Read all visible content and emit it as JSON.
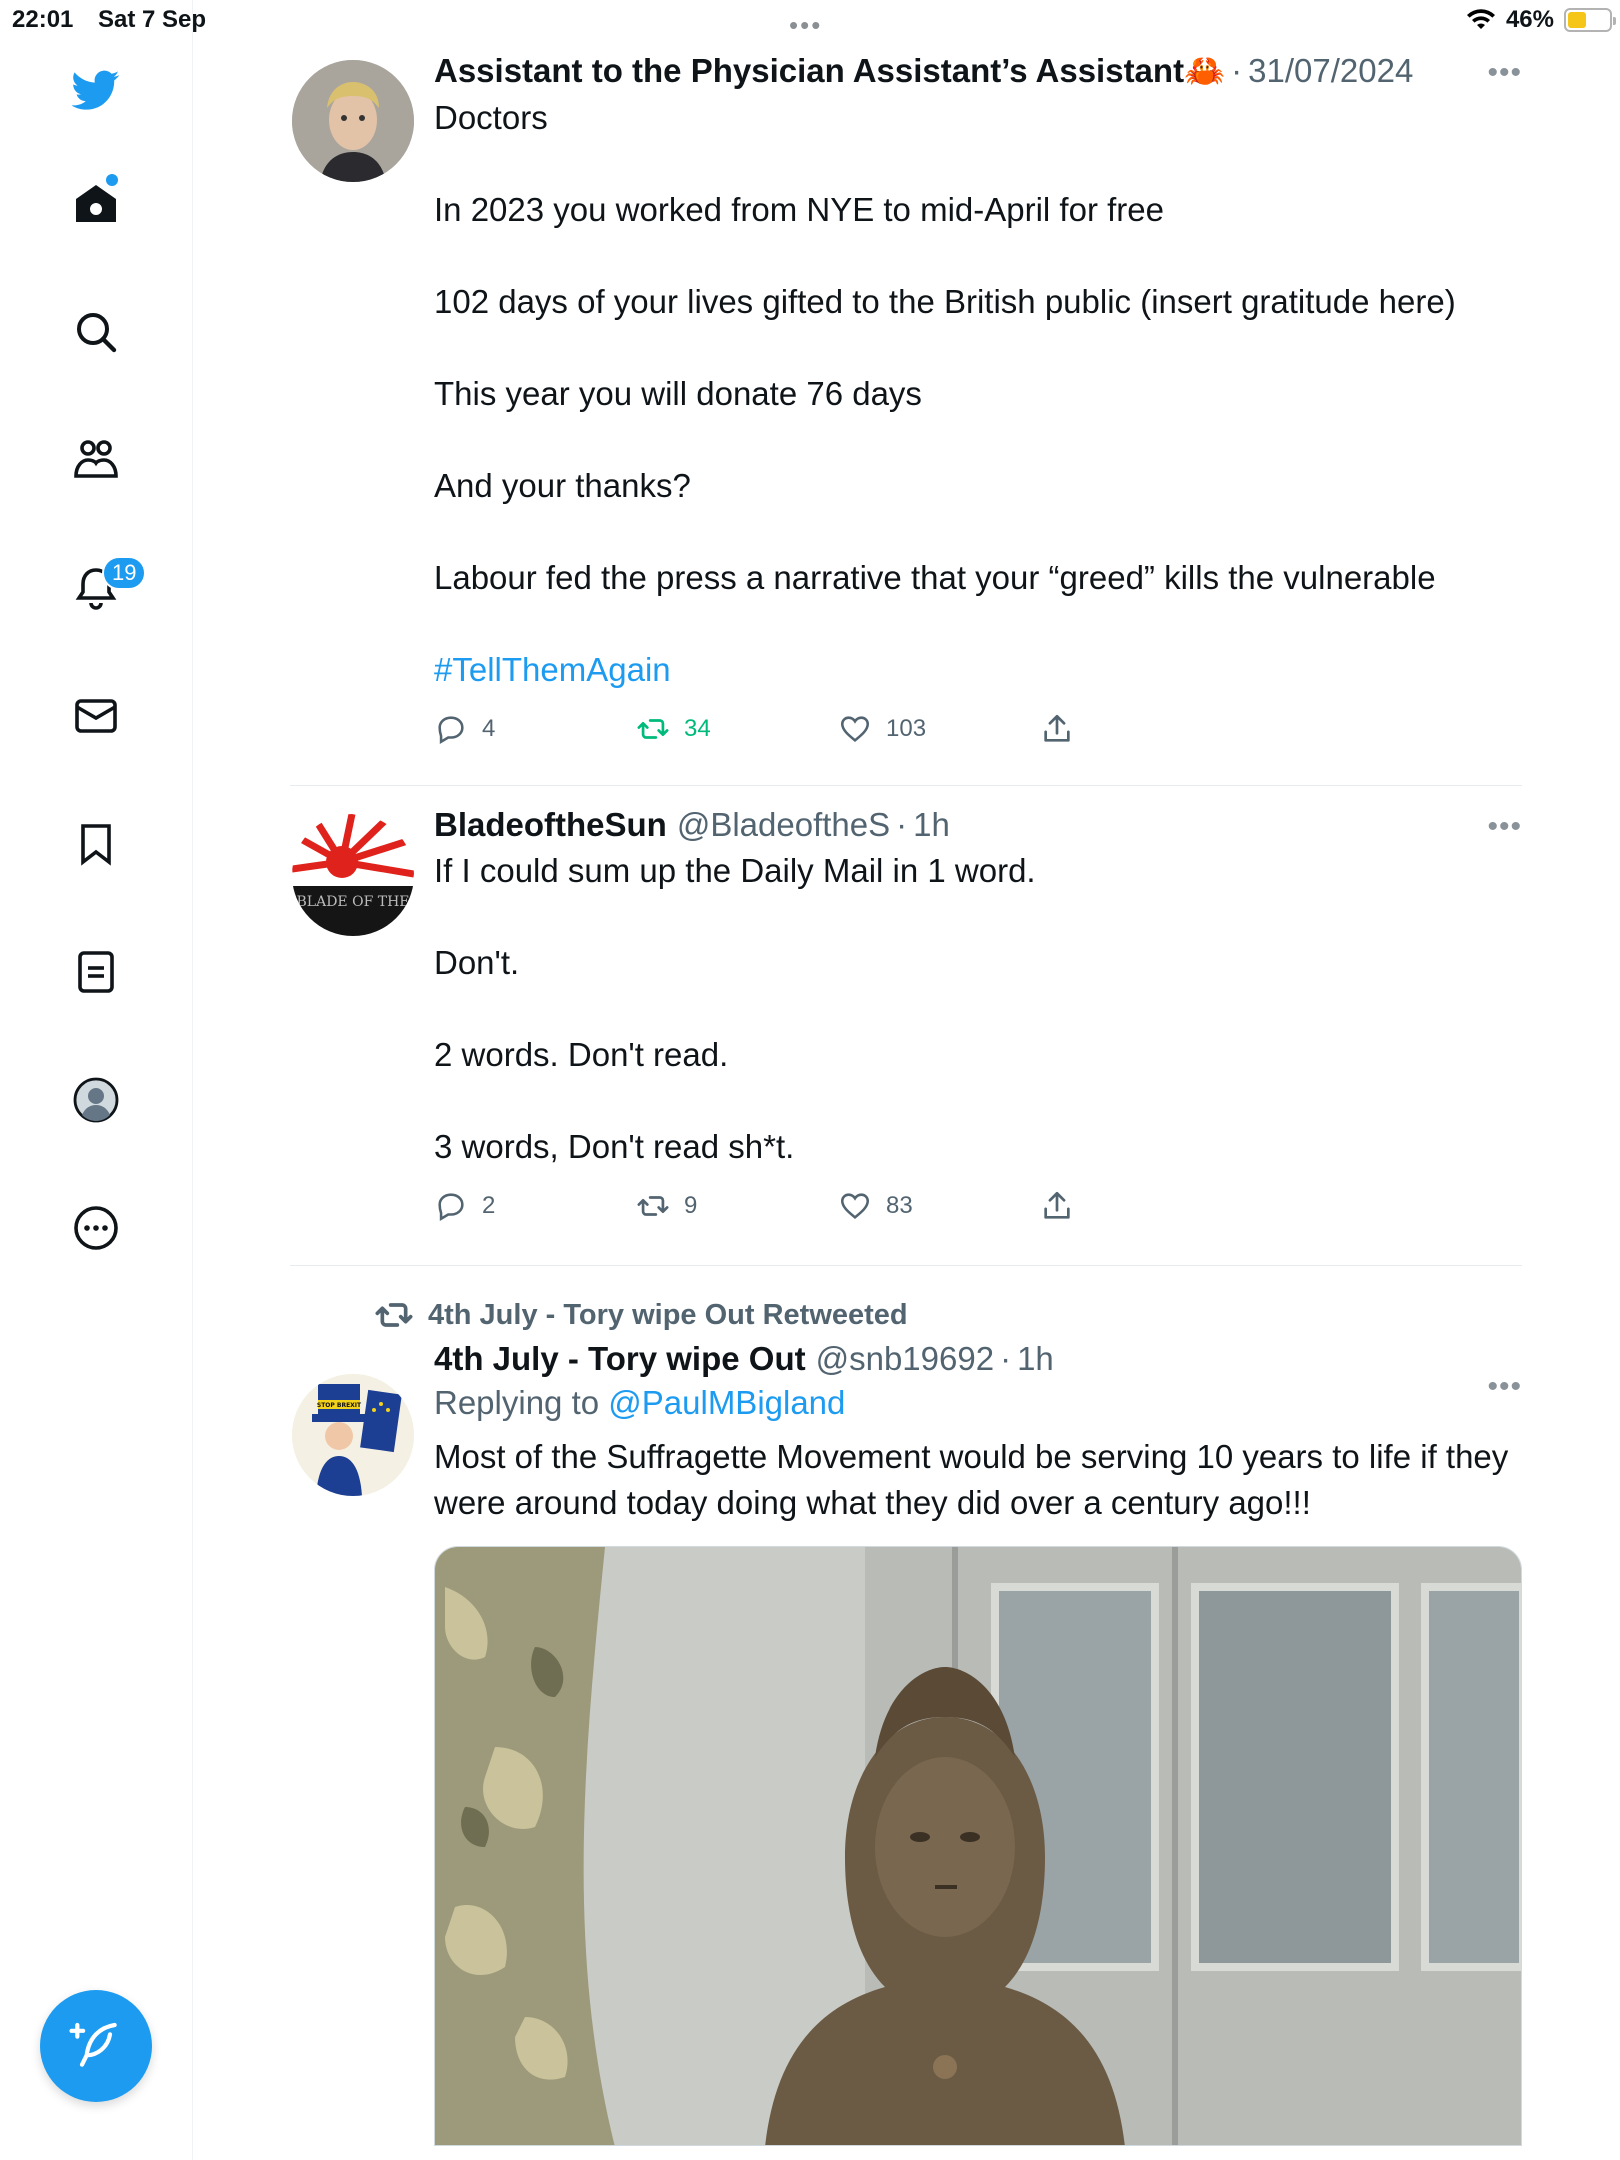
{
  "status_bar": {
    "time": "22:01",
    "date": "Sat 7 Sep",
    "battery": "46%",
    "battery_level": 0.46
  },
  "sidebar": {
    "notifications_badge": "19",
    "icons": [
      "twitter-logo",
      "home-icon",
      "search-icon",
      "communities-icon",
      "notifications-icon",
      "messages-icon",
      "bookmarks-icon",
      "lists-icon",
      "profile-icon",
      "more-icon",
      "compose-icon"
    ]
  },
  "tweets": [
    {
      "name": "Assistant to the Physician Assistant’s Assistant🦀",
      "handle": "",
      "time": "31/07/2024",
      "lines": [
        "Doctors",
        "In 2023 you worked from NYE to mid-April for free",
        "102 days of your lives gifted to the British public (insert gratitude here)",
        "This year you will donate 76 days",
        "And your thanks?",
        "Labour fed the press a narrative that your “greed” kills the vulnerable"
      ],
      "hashtag": "#TellThemAgain",
      "replies": "4",
      "retweets": "34",
      "likes": "103"
    },
    {
      "name": "BladeoftheSun",
      "handle": "@BladeoftheS",
      "time": "1h",
      "avatar_text": "BLADE OF THE",
      "lines": [
        "If I could sum up the Daily Mail in 1 word.",
        "Don't.",
        "2 words. Don't read.",
        "3 words, Don't read sh*t."
      ],
      "replies": "2",
      "retweets": "9",
      "likes": "83"
    },
    {
      "retweeted_by": "4th July - Tory wipe Out Retweeted",
      "name": "4th July - Tory wipe Out",
      "handle": "@snb19692",
      "time": "1h",
      "replying_prefix": "Replying to ",
      "replying_to": "@PaulMBigland",
      "avatar_sign": "STOP BREXIT",
      "text": "Most of the Suffragette Movement would be serving 10 years to life if they were around today doing what they did over a century ago!!!"
    }
  ],
  "colors": {
    "accent": "#1d9bf0",
    "retweet_green": "#00ba7c",
    "secondary_text": "#536471"
  }
}
